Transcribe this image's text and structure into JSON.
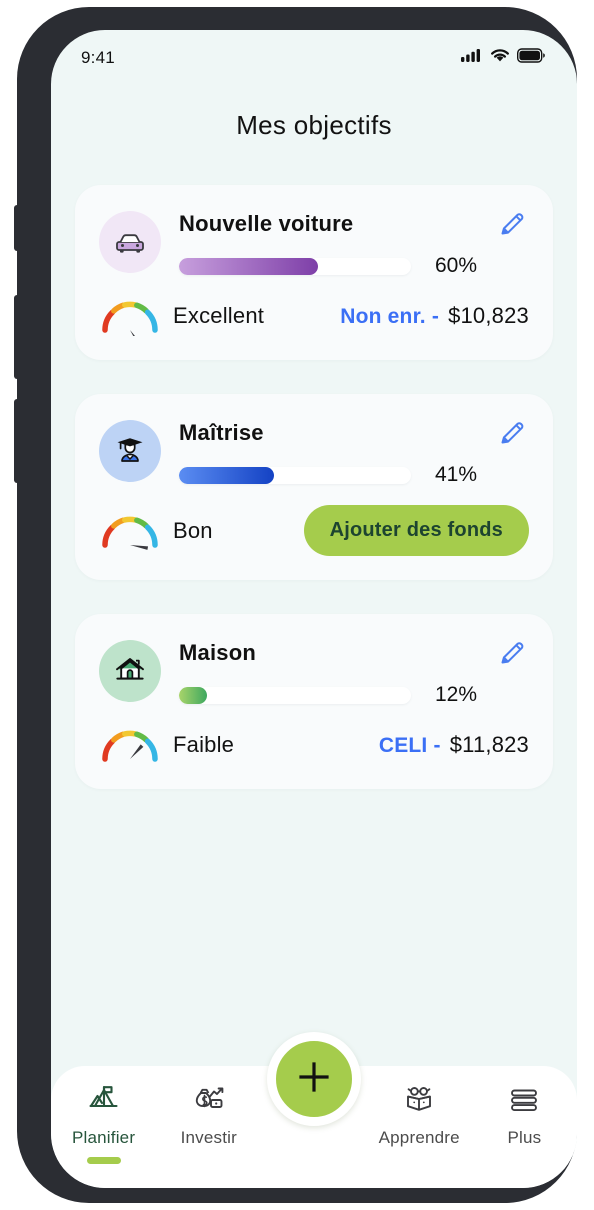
{
  "status_bar": {
    "time": "9:41",
    "icons": [
      "cellular-signal-icon",
      "wifi-icon",
      "battery-icon"
    ]
  },
  "header": {
    "title": "Mes objectifs"
  },
  "colors": {
    "screen_background": "#eff7f6",
    "card_background": "#f9fbfc",
    "accent_green": "#a5cc4c",
    "accent_dark_green": "#27553c",
    "link_blue": "#3b6ff5",
    "edit_icon_blue": "#4a7df0"
  },
  "goals": [
    {
      "name": "Nouvelle voiture",
      "icon": "car-icon",
      "icon_bg": "#f1e7f6",
      "progress_percent": 60,
      "progress_label": "60%",
      "bar_from": "#c79fdd",
      "bar_to": "#7e3fa8",
      "rating": "Excellent",
      "gauge_angle": 56,
      "account_tag": "Non enr. -",
      "amount": "$10,823",
      "action_button": null
    },
    {
      "name": "Maîtrise",
      "icon": "graduation-cap-icon",
      "icon_bg": "#bdd3f5",
      "progress_percent": 41,
      "progress_label": "41%",
      "bar_from": "#5b8df2",
      "bar_to": "#1442c4",
      "rating": "Bon",
      "gauge_angle": 10,
      "account_tag": null,
      "amount": null,
      "action_button": "Ajouter des fonds"
    },
    {
      "name": "Maison",
      "icon": "house-icon",
      "icon_bg": "#bee3cb",
      "progress_percent": 12,
      "progress_label": "12%",
      "bar_from": "#a8d46a",
      "bar_to": "#3fa85f",
      "rating": "Faible",
      "gauge_angle": -48,
      "account_tag": "CELI -",
      "amount": "$11,823",
      "action_button": null
    }
  ],
  "edit_icon_name": "edit-pencil-icon",
  "bottom_nav": {
    "items": [
      {
        "label": "Planifier",
        "icon": "mountain-flag-icon",
        "active": true
      },
      {
        "label": "Investir",
        "icon": "money-bag-chart-icon",
        "active": false
      },
      {
        "label": "Apprendre",
        "icon": "learn-box-glasses-icon",
        "active": false
      },
      {
        "label": "Plus",
        "icon": "menu-lines-icon",
        "active": false
      }
    ],
    "fab": {
      "icon": "plus-icon",
      "label": "+"
    }
  }
}
